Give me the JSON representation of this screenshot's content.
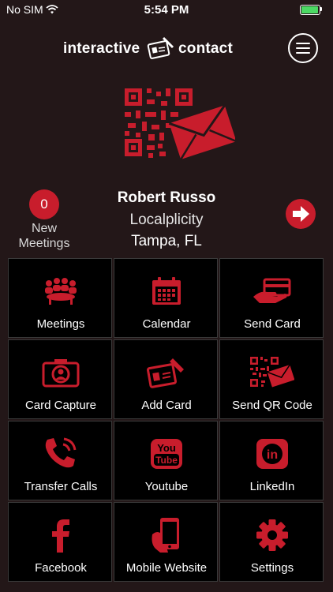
{
  "status_bar": {
    "carrier": "No SIM",
    "time": "5:54 PM"
  },
  "brand": {
    "left": "interactive",
    "right": "contact",
    "accent": "#c81d2c"
  },
  "meetings": {
    "count": "0",
    "label": "New Meetings"
  },
  "profile": {
    "name": "Robert Russo",
    "company": "Localplicity",
    "location": "Tampa, FL"
  },
  "tiles": [
    {
      "label": "Meetings",
      "icon": "meeting-icon"
    },
    {
      "label": "Calendar",
      "icon": "calendar-icon"
    },
    {
      "label": "Send Card",
      "icon": "hand-card-icon"
    },
    {
      "label": "Card Capture",
      "icon": "camera-icon"
    },
    {
      "label": "Add Card",
      "icon": "add-card-icon"
    },
    {
      "label": "Send QR Code",
      "icon": "qr-mail-icon"
    },
    {
      "label": "Transfer Calls",
      "icon": "phone-icon"
    },
    {
      "label": "Youtube",
      "icon": "youtube-icon"
    },
    {
      "label": "LinkedIn",
      "icon": "linkedin-icon"
    },
    {
      "label": "Facebook",
      "icon": "facebook-icon"
    },
    {
      "label": "Mobile Website",
      "icon": "mobile-phone-icon"
    },
    {
      "label": "Settings",
      "icon": "gear-icon"
    }
  ]
}
